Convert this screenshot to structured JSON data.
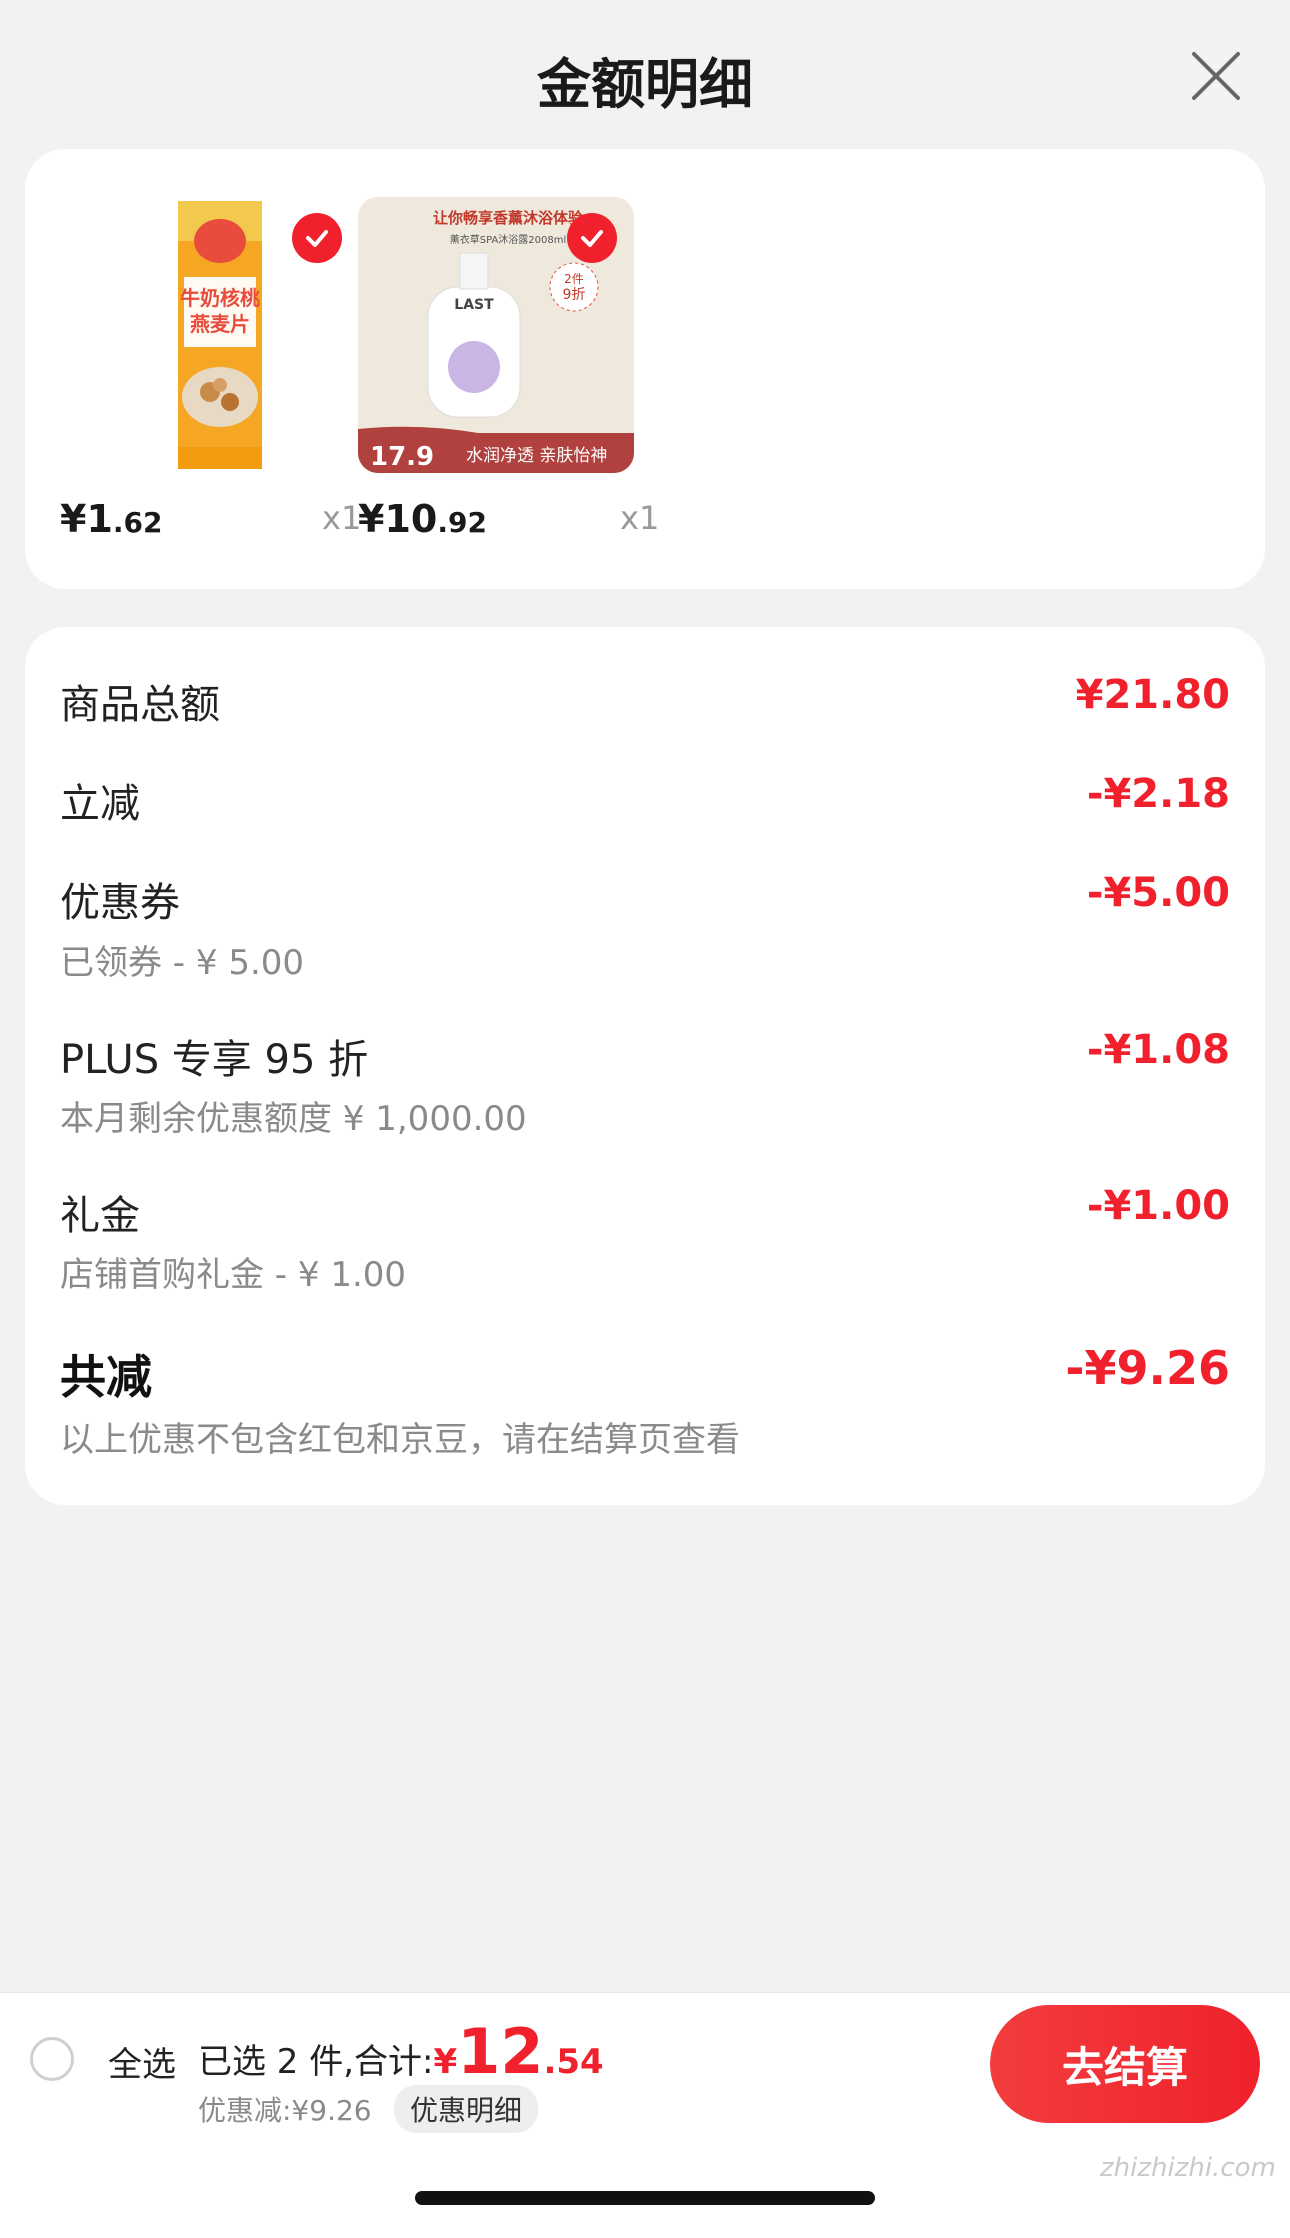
{
  "header": {
    "title": "金额明细"
  },
  "products": [
    {
      "price_symbol": "¥",
      "price_int": "1",
      "price_dec": ".62",
      "qty": "x1",
      "thumb_text": [
        "牛奶核桃",
        "燕麦片"
      ]
    },
    {
      "price_symbol": "¥",
      "price_int": "10",
      "price_dec": ".92",
      "qty": "x1",
      "thumb_text": {
        "banner": "让你畅享香薰沐浴体验",
        "sub": "薰衣草SPA沐浴露2008ml",
        "promo": "2件\n9折",
        "brand": "LAST",
        "price": "17.9",
        "slogan": "水润净透 亲肤怡神"
      }
    }
  ],
  "details": {
    "rows": [
      {
        "label": "商品总额",
        "value": "¥21.80",
        "sub": ""
      },
      {
        "label": "立减",
        "value": "-¥2.18",
        "sub": ""
      },
      {
        "label": "优惠券",
        "value": "-¥5.00",
        "sub": "已领券 - ¥ 5.00"
      },
      {
        "label": "PLUS 专享 95 折",
        "value": "-¥1.08",
        "sub": "本月剩余优惠额度 ¥ 1,000.00"
      },
      {
        "label": "礼金",
        "value": "-¥1.00",
        "sub": "店铺首购礼金 - ¥ 1.00"
      }
    ],
    "total": {
      "label": "共减",
      "value": "-¥9.26",
      "note": "以上优惠不包含红包和京豆，请在结算页查看"
    }
  },
  "bottom": {
    "select_all": "全选",
    "selected_text": "已选 2 件,合计:",
    "currency": "¥",
    "total_int": "12",
    "total_dec": ".54",
    "discount": "优惠减:¥9.26",
    "detail_link": "优惠明细",
    "checkout": "去结算",
    "watermark": "zhizhizhi.com"
  },
  "colors": {
    "accent": "#f0212c",
    "background": "#f2f2f2",
    "card": "#ffffff"
  }
}
